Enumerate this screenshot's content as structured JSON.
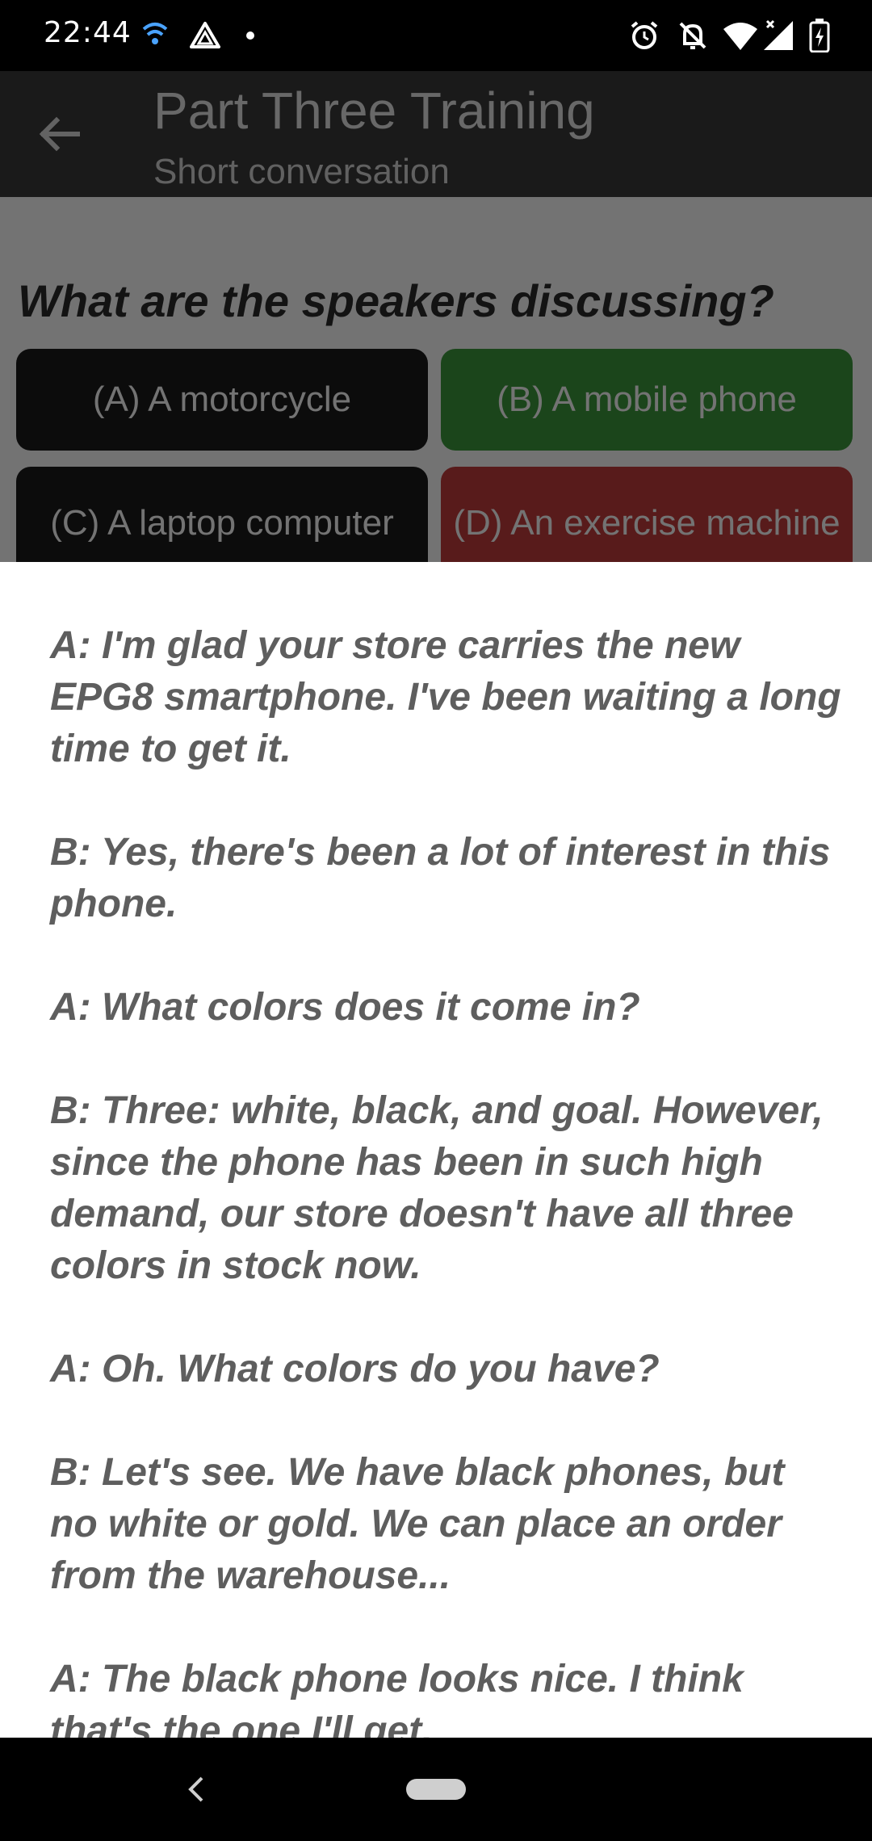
{
  "status_bar": {
    "time": "22:44",
    "left_icons": [
      "wifi-signal-icon",
      "drive-icon",
      "dot-icon"
    ],
    "right_icons": [
      "alarm-icon",
      "notifications-off-icon",
      "wifi-icon",
      "cell-signal-icon",
      "battery-charging-icon"
    ]
  },
  "app_bar": {
    "title": "Part Three Training",
    "subtitle": "Short conversation",
    "back_icon": "arrow-back-icon"
  },
  "question": {
    "text": "What are the speakers discussing?",
    "options": [
      {
        "label": "(A) A motorcycle",
        "state": "neutral",
        "color": "#1b1b1b"
      },
      {
        "label": "(B) A mobile phone",
        "state": "correct",
        "color": "#3d9a3d"
      },
      {
        "label": "(C) A laptop computer",
        "state": "neutral",
        "color": "#1b1b1b"
      },
      {
        "label": "(D) An exercise machine",
        "state": "wrong",
        "color": "#c43c3c"
      }
    ]
  },
  "transcript": {
    "lines": [
      "A: I'm glad your store carries the new EPG8 smartphone. I've been waiting a long time to get it.",
      "B: Yes, there's been a lot of interest in this phone.",
      "A: What colors does it come in?",
      "B: Three: white, black, and goal. However, since the phone has been in such high demand, our store doesn't have all three colors in stock now.",
      "A: Oh. What colors do you have?",
      "B: Let's see. We have black phones, but no white or gold. We can place an order from the warehouse...",
      "A: The black phone looks nice. I think that's the one I'll get."
    ]
  },
  "nav_bar": {
    "back_icon": "nav-back-icon",
    "home_icon": "nav-home-pill-icon"
  }
}
